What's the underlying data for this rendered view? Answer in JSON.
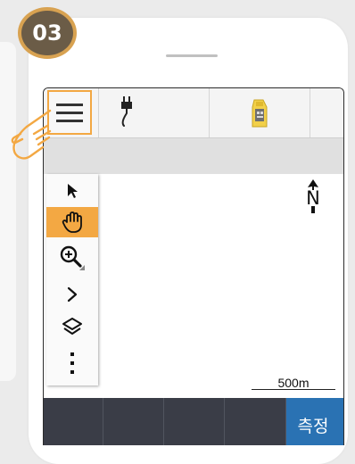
{
  "step_badge": {
    "number": "03"
  },
  "colors": {
    "badge_ring": "#d8a251",
    "badge_fill": "#6b5c47",
    "highlight": "#f3a843",
    "bottom_bar": "#3a3d47",
    "measure_button": "#2a72b3"
  },
  "top_bar": {
    "menu_icon": "hamburger-menu-icon",
    "items": [
      {
        "icon": "power-plug-icon"
      },
      {
        "icon": "instrument-icon"
      }
    ]
  },
  "tool_strip": {
    "tools": [
      {
        "icon": "select-arrow-icon"
      },
      {
        "icon": "pan-hand-icon",
        "active": true
      },
      {
        "icon": "zoom-in-icon"
      },
      {
        "icon": "expand-chevron-icon"
      },
      {
        "icon": "layers-icon"
      },
      {
        "icon": "more-vertical-icon"
      }
    ]
  },
  "map": {
    "north_label": "N",
    "scale_label": "500m"
  },
  "bottom_bar": {
    "measure_label": "측정"
  },
  "pointer": {
    "icon": "tap-hand-icon"
  }
}
